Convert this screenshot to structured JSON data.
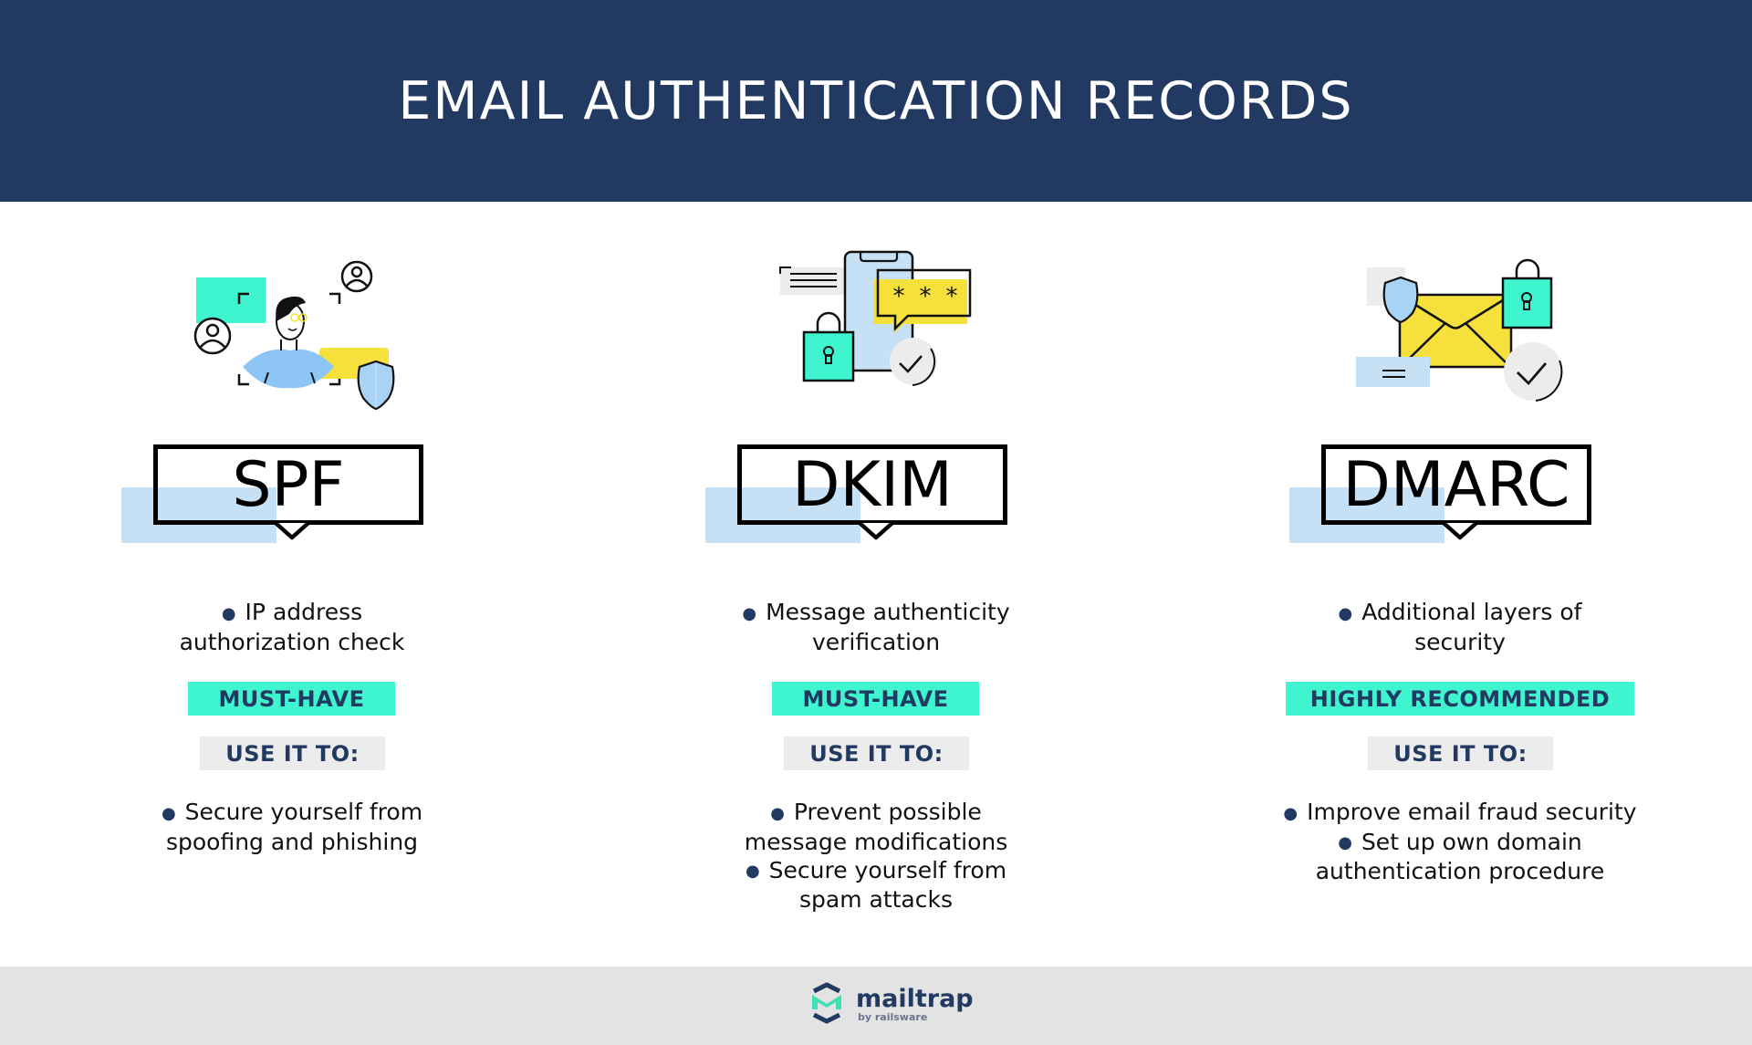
{
  "header": {
    "title": "EMAIL AUTHENTICATION RECORDS"
  },
  "colors": {
    "navy": "#223962",
    "teal": "#3ef5cf",
    "light_blue": "#c6e0f6",
    "yellow": "#f5e03c",
    "grey": "#ececec"
  },
  "records": [
    {
      "name": "SPF",
      "illustration": "person-verification-illustration",
      "description": [
        "IP address",
        "authorization check"
      ],
      "level": "MUST-HAVE",
      "use_label": "USE IT TO:",
      "uses": [
        [
          "Secure yourself from",
          "spoofing and phishing"
        ]
      ]
    },
    {
      "name": "DKIM",
      "illustration": "phone-password-lock-illustration",
      "description": [
        "Message authenticity",
        "verification"
      ],
      "level": "MUST-HAVE",
      "use_label": "USE IT TO:",
      "uses": [
        [
          "Prevent possible",
          "message modifications"
        ],
        [
          "Secure yourself from",
          "spam attacks"
        ]
      ]
    },
    {
      "name": "DMARC",
      "illustration": "envelope-lock-shield-illustration",
      "description": [
        "Additional layers of",
        "security"
      ],
      "level": "HIGHLY RECOMMENDED",
      "use_label": "USE IT TO:",
      "uses": [
        [
          "Improve email fraud security"
        ],
        [
          "Set up own domain",
          "authentication procedure"
        ]
      ]
    }
  ],
  "footer": {
    "brand": "mailtrap",
    "sub": "by railsware"
  }
}
